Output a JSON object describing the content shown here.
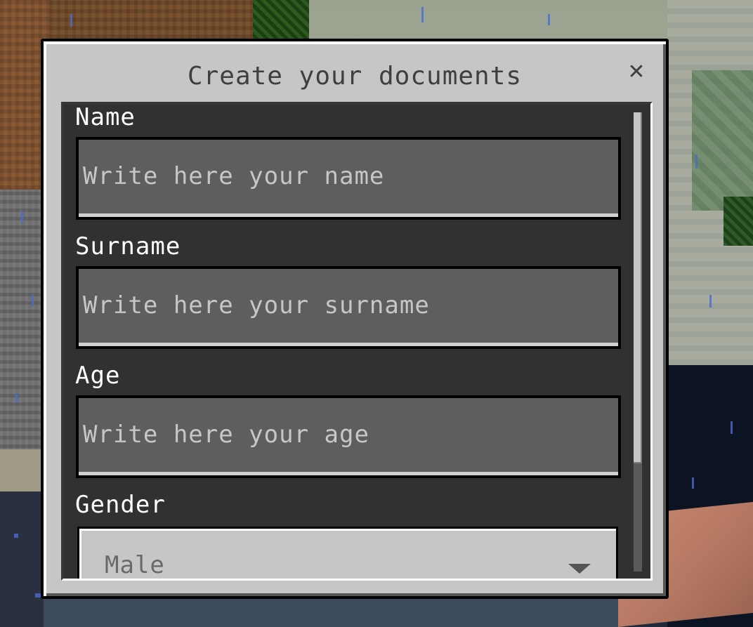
{
  "dialog": {
    "title": "Create your documents",
    "close_icon": "close-icon"
  },
  "form": {
    "name": {
      "label": "Name",
      "value": "",
      "placeholder": "Write here your name"
    },
    "surname": {
      "label": "Surname",
      "value": "",
      "placeholder": "Write here your surname"
    },
    "age": {
      "label": "Age",
      "value": "",
      "placeholder": "Write here your age"
    },
    "gender": {
      "label": "Gender",
      "selected": "Male",
      "icon": "chevron-down-icon"
    }
  },
  "colors": {
    "dialog_bg": "#c6c6c6",
    "panel_bg": "#101010",
    "field_bg": "#5e5e5e",
    "label_text": "#ffffff",
    "placeholder_text": "#c7c7c7"
  }
}
